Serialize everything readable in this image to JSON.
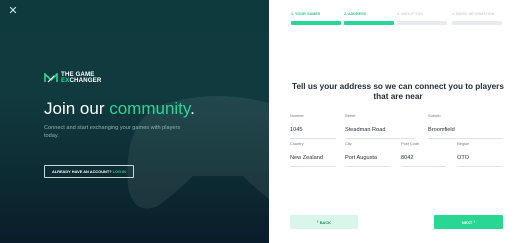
{
  "left_panel": {
    "close_icon": "close-icon",
    "logo": {
      "line1": "THE GAME",
      "line2_accent": "EX",
      "line2_rest": "CHANGER",
      "mark_color": "#2ad693"
    },
    "headline": {
      "prefix": "Join our",
      "accent": "community",
      "suffix": "."
    },
    "subtext": "Connect and start exchanging your games with players today.",
    "account_button": {
      "question": "ALREADY HAVE AN ACCOUNT?",
      "link": "LOG IN"
    }
  },
  "steps": [
    {
      "label": "1. YOUR GAMES",
      "active": true
    },
    {
      "label": "2. ADDRESS",
      "active": true
    },
    {
      "label": "3. ABOUT YOU",
      "active": false
    },
    {
      "label": "4. BASIC INFORMATION",
      "active": false
    }
  ],
  "form": {
    "title": "Tell us your address so we can connect you to players that are near",
    "fields": {
      "number": {
        "label": "Number",
        "value": "1045"
      },
      "street": {
        "label": "Street",
        "value": "Steadman Road"
      },
      "suburb": {
        "label": "Suburb",
        "value": "Broomfield"
      },
      "country": {
        "label": "Country",
        "value": "New Zealand"
      },
      "city": {
        "label": "City",
        "value": "Port Augusta"
      },
      "post_code": {
        "label": "Post Code",
        "value": "8042"
      },
      "region": {
        "label": "Region",
        "value": "OTO"
      }
    }
  },
  "buttons": {
    "back": "BACK",
    "next": "NEXT"
  },
  "colors": {
    "accent": "#2ad693",
    "panel_dark": "#0f3a3d",
    "back_bg": "#d9f6ea"
  }
}
